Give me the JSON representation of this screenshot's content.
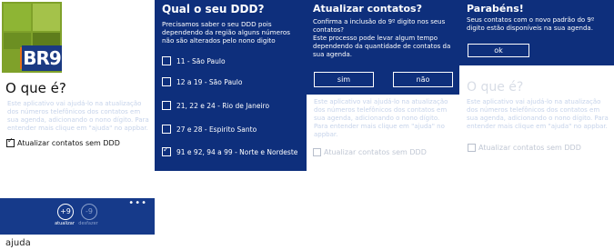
{
  "panel1": {
    "logo_text": "BR9",
    "heading": "O que é?",
    "description": "Este aplicativo vai ajudá-lo na atualização dos números telefônicos dos contatos em sua agenda, adicionando o nono dígito. Para entender mais clique em \"ajuda\" no appbar.",
    "checkbox_label": "Atualizar contatos sem DDD",
    "appbar": {
      "more": "•••",
      "btn1_icon": "+9",
      "btn1_label": "atualizar",
      "btn2_icon": "-9",
      "btn2_label": "desfazer"
    },
    "menu_item": "ajuda"
  },
  "panel2": {
    "title": "Qual o seu DDD?",
    "description": "Precisamos saber o seu DDD pois dependendo da região alguns números não são alterados pelo nono digito",
    "options": [
      {
        "label": "11 - São Paulo",
        "checked": false
      },
      {
        "label": "12 a 19 - São Paulo",
        "checked": false
      },
      {
        "label": "21, 22 e 24 - Rio de Janeiro",
        "checked": false
      },
      {
        "label": "27 e 28 - Espirito Santo",
        "checked": false
      },
      {
        "label": "91 e 92, 94 a 99 - Norte e Nordeste",
        "checked": true
      }
    ]
  },
  "panel3": {
    "title": "Atualizar contatos?",
    "description": "Confirma a inclusão do 9º digito nos seus contatos?\nEste processo pode levar algum tempo dependendo da quantidade de contatos da sua agenda.",
    "yes_label": "sim",
    "no_label": "não",
    "bg_description": "Este aplicativo vai ajudá-lo na atualização dos números telefônicos dos contatos em sua agenda, adicionando o nono dígito. Para entender mais clique em \"ajuda\" no appbar.",
    "bg_checkbox_label": "Atualizar contatos sem DDD"
  },
  "panel4": {
    "title": "Parabéns!",
    "description": "Seus contatos com o novo padrão do 9º digito estão disponíveis na sua agenda.",
    "ok_label": "ok",
    "bg_heading": "O que é?",
    "bg_description": "Este aplicativo vai ajudá-lo na atualização dos números telefônicos dos contatos em sua agenda, adicionando o nono dígito. Para entender mais clique em \"ajuda\" no appbar.",
    "bg_checkbox_label": "Atualizar contatos sem DDD"
  },
  "colors": {
    "dialog_bg": "#0e2f7c",
    "appbar_bg": "#163a8a",
    "logo_green": "#7fa12a",
    "logo_orange": "#e36f1a",
    "faded_text": "#c6d3ea"
  }
}
